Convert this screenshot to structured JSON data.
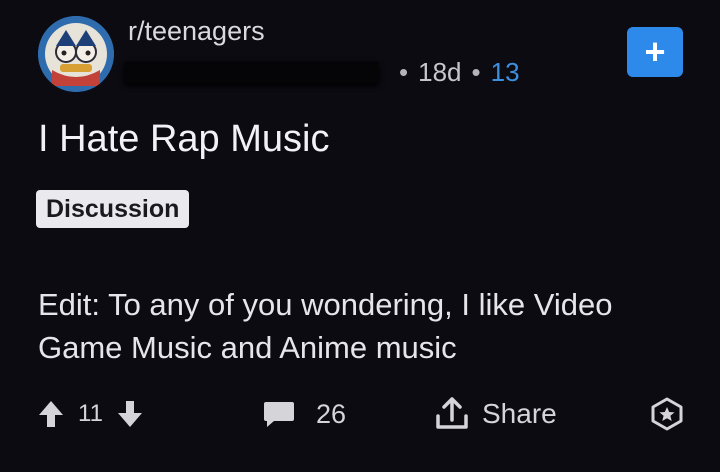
{
  "post": {
    "subreddit": "r/teenagers",
    "time_ago": "18d",
    "meta_count": "13",
    "title": "I Hate Rap Music",
    "flair": "Discussion",
    "body": "Edit: To any of you wondering, I like Video Game Music and Anime music"
  },
  "actions": {
    "vote_count": "11",
    "comment_count": "26",
    "share_label": "Share"
  },
  "icons": {
    "upvote": "arrow-up-icon",
    "downvote": "arrow-down-icon",
    "comment": "comment-bubble-icon",
    "share": "share-icon",
    "award": "award-icon",
    "join": "plus-icon"
  },
  "colors": {
    "background": "#0c0b12",
    "accent_blue": "#2d89ea",
    "flair_bg": "#e9e9ee"
  }
}
